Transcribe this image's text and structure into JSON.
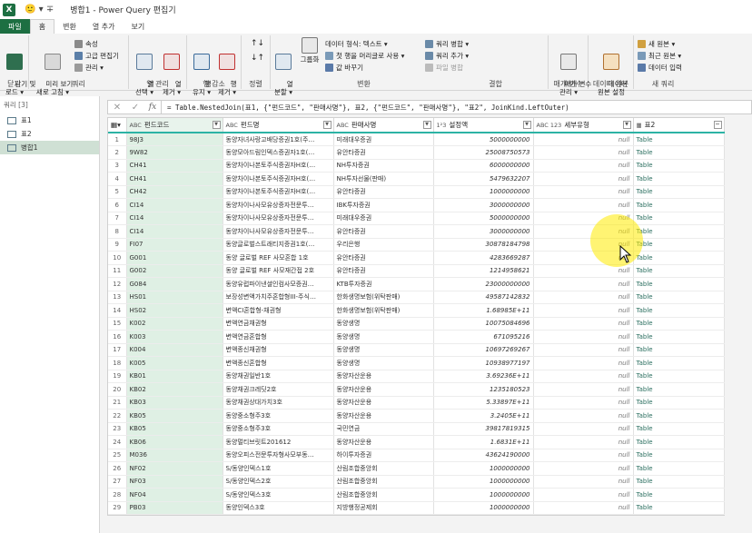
{
  "titlebar": {
    "app_icon": "X",
    "qat": "🙂 ▾ ∓",
    "title": "병합1 - Power Query 편집기"
  },
  "ribbon_tabs": [
    "파일",
    "홈",
    "변환",
    "열 추가",
    "보기"
  ],
  "ribbon": {
    "close": {
      "button": "닫기 및\n로드 ▾",
      "group": "닫기"
    },
    "query": {
      "preview": "미리 보기\n새로 고침 ▾",
      "properties": "속성",
      "advanced": "고급 편집기",
      "manage": "관리 ▾",
      "group": "쿼리"
    },
    "columns": {
      "select": "열\n선택 ▾",
      "remove": "열\n제거 ▾",
      "group": "열 관리"
    },
    "rows": {
      "keep": "행\n유지 ▾",
      "remove": "행\n제거 ▾",
      "group": "행 감소"
    },
    "sort": {
      "group": "정렬"
    },
    "split": {
      "label": "열\n분할 ▾"
    },
    "groupby": {
      "label": "그룹화"
    },
    "transform": {
      "datatype": "데이터 형식: 텍스트 ▾",
      "headers": "첫 행을 머리글로 사용 ▾",
      "replace": "값 바꾸기",
      "group": "변환"
    },
    "combine": {
      "merge": "쿼리 병합 ▾",
      "append": "쿼리 추가 ▾",
      "combine_files": "파일 병합",
      "group": "결합"
    },
    "params": {
      "manage": "매개 변수\n관리 ▾",
      "group": "매개 변수"
    },
    "datasource": {
      "settings": "데이터\n원본 설정",
      "group": "데이터 원본"
    },
    "newquery": {
      "new_source": "새 원본 ▾",
      "recent": "최근 원본 ▾",
      "enter": "데이터 입력",
      "group": "새 쿼리"
    }
  },
  "queries": {
    "header": "쿼리 [3]",
    "items": [
      "표1",
      "표2",
      "병합1"
    ]
  },
  "formula": "= Table.NestedJoin(표1, {\"펀드코드\", \"판매사명\"}, 표2, {\"펀드코드\", \"판매사명\"}, \"표2\", JoinKind.LeftOuter)",
  "columns": [
    {
      "type": "ABC",
      "name": "펀드코드"
    },
    {
      "type": "ABC",
      "name": "펀드명"
    },
    {
      "type": "ABC",
      "name": "판매사명"
    },
    {
      "type": "1²3",
      "name": "설정액"
    },
    {
      "type": "ABC 123",
      "name": "세부유형"
    },
    {
      "type": "▦",
      "name": "표2"
    }
  ],
  "rows": [
    [
      "98J3",
      "동양자녀사랑고배당증권1호(주…",
      "미래대우증권",
      "5000000000",
      "null",
      "Table"
    ],
    [
      "9W82",
      "동양모아드림인덱스증권자1호(…",
      "유안타증권",
      "25008750573",
      "null",
      "Table"
    ],
    [
      "CH41",
      "동양차이나본토주식증권자H호(…",
      "NH투자증권",
      "6000000000",
      "null",
      "Table"
    ],
    [
      "CH41",
      "동양차이나본토주식증권자H호(…",
      "NH투자선물(판매)",
      "5479632207",
      "null",
      "Table"
    ],
    [
      "CH42",
      "동양차이나본토주식증권자H호(…",
      "유안타증권",
      "1000000000",
      "null",
      "Table"
    ],
    [
      "CI14",
      "동양차이나사모유상증자전문투…",
      "IBK투자증권",
      "3000000000",
      "null",
      "Table"
    ],
    [
      "CI14",
      "동양차이나사모유상증자전문투…",
      "미래대우증권",
      "5000000000",
      "null",
      "Table"
    ],
    [
      "CI14",
      "동양차이나사모유상증자전문투…",
      "유안타증권",
      "3000000000",
      "null",
      "Table"
    ],
    [
      "FI07",
      "동양글로벌스트래티지증권1호(…",
      "우리은행",
      "30878184798",
      "null",
      "Table"
    ],
    [
      "G001",
      "동양 글로벌 REF 사모혼합 1호",
      "유안타증권",
      "4283669287",
      "null",
      "Table"
    ],
    [
      "G002",
      "동양 글로벌 REF 사모재간접 2호",
      "유안타증권",
      "1214958621",
      "null",
      "Table"
    ],
    [
      "G084",
      "동양유럽파이낸셜인컴사모증권…",
      "KTB투자증권",
      "23000000000",
      "null",
      "Table"
    ],
    [
      "HS01",
      "보장성변액가치주혼합형III-주식…",
      "한화생명보험(위탁판매)",
      "49587142832",
      "null",
      "Table"
    ],
    [
      "HS02",
      "변액CI혼합형-채권형",
      "한화생명보험(위탁판매)",
      "1.68985E+11",
      "null",
      "Table"
    ],
    [
      "K002",
      "변액연금채권형",
      "동양생명",
      "10075084696",
      "null",
      "Table"
    ],
    [
      "K003",
      "변액연금혼합형",
      "동양생명",
      "671095216",
      "null",
      "Table"
    ],
    [
      "K004",
      "변액종신채권형",
      "동양생명",
      "10697269267",
      "null",
      "Table"
    ],
    [
      "K005",
      "변액종신혼합형",
      "동양생명",
      "10938977197",
      "null",
      "Table"
    ],
    [
      "KB01",
      "동양채권일반1호",
      "동양자산운용",
      "3.69236E+11",
      "null",
      "Table"
    ],
    [
      "KB02",
      "동양채권크레딧2호",
      "동양자산운용",
      "1235180523",
      "null",
      "Table"
    ],
    [
      "KB03",
      "동양채권상대가치3호",
      "동양자산운용",
      "5.33897E+11",
      "null",
      "Table"
    ],
    [
      "KB05",
      "동양중소형주3호",
      "동양자산운용",
      "3.2405E+11",
      "null",
      "Table"
    ],
    [
      "KB05",
      "동양중소형주3호",
      "국민연금",
      "39817819315",
      "null",
      "Table"
    ],
    [
      "KB06",
      "동양멀티브릿트201612",
      "동양자산운용",
      "1.6831E+11",
      "null",
      "Table"
    ],
    [
      "M036",
      "동양오피스전문투자형사모부동…",
      "하이투자증권",
      "43624190000",
      "null",
      "Table"
    ],
    [
      "NF02",
      "S/동양인덱스1호",
      "산림조합중앙회",
      "1000000000",
      "null",
      "Table"
    ],
    [
      "NF03",
      "S/동양인덱스2호",
      "산림조합중앙회",
      "1000000000",
      "null",
      "Table"
    ],
    [
      "NF04",
      "S/동양인덱스3호",
      "산림조합중앙회",
      "1000000000",
      "null",
      "Table"
    ],
    [
      "PB03",
      "동양인덱스3호",
      "지방행정공제회",
      "1000000000",
      "null",
      "Table"
    ]
  ]
}
